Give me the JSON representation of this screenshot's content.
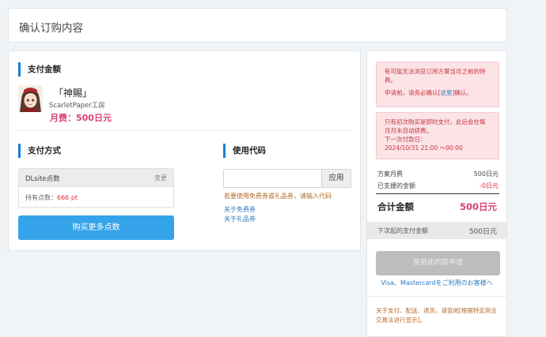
{
  "page": {
    "title": "确认订购内容"
  },
  "payment": {
    "section_title": "支付金额",
    "work_title": "「神賜」",
    "circle": "ScarletPaper工房",
    "monthly_fee": "月费：500日元"
  },
  "method": {
    "section_title": "支付方式",
    "name": "DLsite点数",
    "change_label": "变更",
    "points_label": "持有点数：",
    "points_value": "666 pt",
    "buy_button": "购买更多点数"
  },
  "code": {
    "section_title": "使用代码",
    "input_value": "",
    "apply_button": "应用",
    "hint": "若要使用免费券或礼品券，请输入代码",
    "link_coupon": "关于免费券",
    "link_gift": "关于礼品券"
  },
  "sidebar": {
    "alert1_line1": "有可能无法浏览订阅方案当月之前的特典。",
    "alert1_line2_pre": "申请前，请务必确认[",
    "alert1_link": "这里",
    "alert1_line2_post": "]确认。",
    "alert2_line1": "只有初次购买是即时支付，此后会在每月月末自动续费。",
    "alert2_line2": "下一次付款日：",
    "alert2_line3": "2024/10/31 21:00 ～00:00",
    "plan_fee_label": "方案月费",
    "plan_fee_value": "500日元",
    "paid_label": "已支援的金额",
    "paid_value": "-0日元",
    "total_label": "合计金额",
    "total_value": "500日元",
    "next_label": "下次起的支付金额",
    "next_value": "500日元",
    "apply_button": "使用此内容申请",
    "card_link": "Visa、Mastercardをご利用のお客様へ",
    "legal": "关于支付、配送、退货，请查阅[根据特定商业交易法进行显示]。"
  },
  "colors": {
    "accent": "#35a3ea",
    "price": "#d93f7a",
    "section_bar": "#1a7ed3",
    "alert_bg": "#fbe3e6"
  }
}
